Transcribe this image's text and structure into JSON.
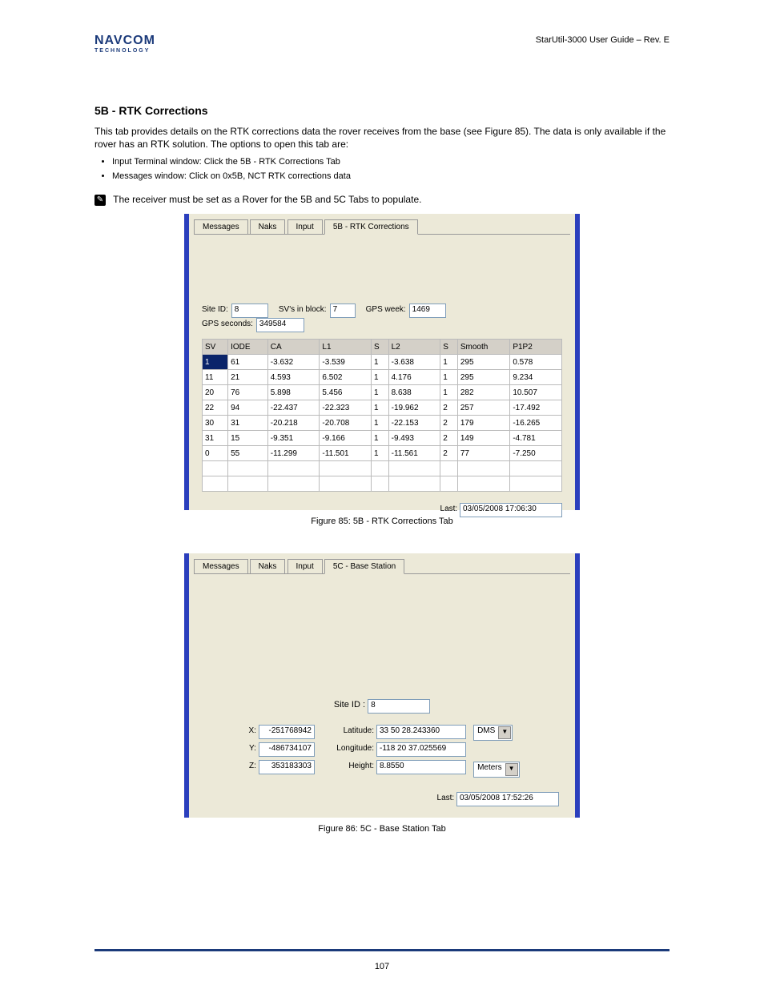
{
  "header": {
    "manual_title": "StarUtil-3000 User Guide – Rev. E",
    "logo_main": "NAVCOM",
    "logo_sub": "TECHNOLOGY"
  },
  "section": {
    "heading": "5B - RTK Corrections",
    "para": "This tab provides details on the RTK corrections data the rover receives from the base (see Figure 85). The data is only available if the rover has an RTK solution. The options to open this tab are:",
    "bullet1": "Input Terminal window: Click the 5B - RTK Corrections Tab",
    "bullet2": "Messages window: Click on 0x5B, NCT RTK corrections data",
    "note_label": "The receiver must be set as a Rover for the 5B and 5C Tabs to populate."
  },
  "panel_5b": {
    "tabs": [
      "Messages",
      "Naks",
      "Input",
      "5B - RTK Corrections"
    ],
    "active_tab": "5B - RTK Corrections",
    "site_id_label": "Site ID:",
    "site_id": "8",
    "sv_block_label": "SV's in block:",
    "sv_block": "7",
    "gps_week_label": "GPS week:",
    "gps_week": "1469",
    "gps_sec_label": "GPS seconds:",
    "gps_sec": "349584",
    "headers": [
      "SV",
      "IODE",
      "CA",
      "L1",
      "S",
      "L2",
      "S",
      "Smooth",
      "P1P2"
    ],
    "rows": [
      [
        "1",
        "61",
        "-3.632",
        "-3.539",
        "1",
        "-3.638",
        "1",
        "295",
        "0.578"
      ],
      [
        "11",
        "21",
        "4.593",
        "6.502",
        "1",
        "4.176",
        "1",
        "295",
        "9.234"
      ],
      [
        "20",
        "76",
        "5.898",
        "5.456",
        "1",
        "8.638",
        "1",
        "282",
        "10.507"
      ],
      [
        "22",
        "94",
        "-22.437",
        "-22.323",
        "1",
        "-19.962",
        "2",
        "257",
        "-17.492"
      ],
      [
        "30",
        "31",
        "-20.218",
        "-20.708",
        "1",
        "-22.153",
        "2",
        "179",
        "-16.265"
      ],
      [
        "31",
        "15",
        "-9.351",
        "-9.166",
        "1",
        "-9.493",
        "2",
        "149",
        "-4.781"
      ],
      [
        "0",
        "55",
        "-11.299",
        "-11.501",
        "1",
        "-11.561",
        "2",
        "77",
        "-7.250"
      ]
    ],
    "last_label": "Last:",
    "last_value": "03/05/2008 17:06:30",
    "caption": "Figure 85: 5B - RTK Corrections Tab"
  },
  "panel_5c": {
    "tabs": [
      "Messages",
      "Naks",
      "Input",
      "5C - Base Station"
    ],
    "active_tab": "5C - Base Station",
    "site_id_label": "Site ID :",
    "site_id": "8",
    "x_label": "X:",
    "x": "-251768942",
    "y_label": "Y:",
    "y": "-486734107",
    "z_label": "Z:",
    "z": "353183303",
    "lat_label": "Latitude:",
    "lat": "33 50 28.243360",
    "lon_label": "Longitude:",
    "lon": "-118 20 37.025569",
    "hgt_label": "Height:",
    "hgt": "8.8550",
    "fmt_sel": "DMS",
    "unit_sel": "Meters",
    "last_label": "Last:",
    "last_value": "03/05/2008 17:52:26",
    "caption": "Figure 86: 5C - Base Station Tab"
  },
  "page_number": "107"
}
